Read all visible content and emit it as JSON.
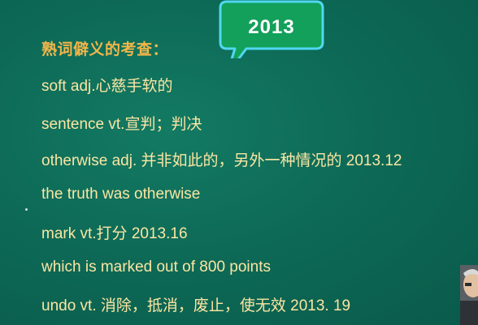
{
  "slide": {
    "heading": "熟词僻义的考查：",
    "badge": "2013",
    "lines": [
      "soft adj.心慈手软的",
      "sentence vt.宣判；判决",
      "otherwise adj. 并非如此的，另外一种情况的 2013.12",
      "the truth was otherwise",
      "mark vt.打分 2013.16",
      "which is marked out of 800 points",
      "undo vt. 消除，抵消，废止，使无效 2013. 19"
    ]
  },
  "colors": {
    "background": "#0d6a57",
    "heading": "#f2b64a",
    "text": "#fbe6a3",
    "bubble_fill": "#13a05a",
    "bubble_border": "#4fd8f0"
  }
}
